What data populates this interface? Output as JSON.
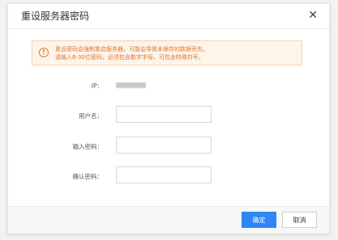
{
  "dialog": {
    "title": "重设服务器密码",
    "close_symbol": "✕"
  },
  "alert": {
    "icon": "!",
    "line1": "重设密码会强制重启服务器，可能会导致未保存的数据丢失。",
    "line2": "请输入8-30位密码，必须包含数字字母，可包含特殊符号。"
  },
  "form": {
    "ip_label": "IP：",
    "username_label": "用户名：",
    "password_label": "输入密码：",
    "confirm_label": "确认密码：",
    "username_value": "",
    "password_value": "",
    "confirm_value": ""
  },
  "footer": {
    "ok_label": "确定",
    "cancel_label": "取消"
  },
  "colors": {
    "primary": "#2f86f6",
    "warning": "#e5772b"
  }
}
